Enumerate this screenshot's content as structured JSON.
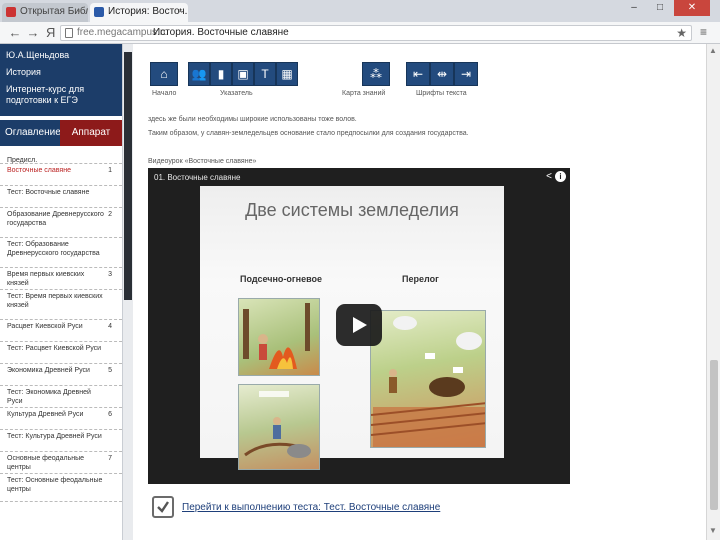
{
  "browser": {
    "tabs": [
      {
        "label": "Открытая Библи..."
      },
      {
        "label": "История: Восточ..."
      }
    ],
    "close_glyph": "×",
    "window_controls": {
      "minimize": "–",
      "maximize": "□",
      "close": "✕"
    },
    "back": "←",
    "forward": "→",
    "yandex_logo": "Я",
    "url": "free.megacampus.ru",
    "page_title": "История. Восточные славяне",
    "star": "★",
    "menu": "≡"
  },
  "sidebar": {
    "header_links": [
      "Ю.А.Щеньдова",
      "История",
      "Интернет-курс для подготовки к ЕГЭ"
    ],
    "tab_toc": "Оглавление",
    "tab_appendix": "Аппарат",
    "items": [
      {
        "label": "Предисл.",
        "num": ""
      },
      {
        "label": "Восточные славяне",
        "num": "1",
        "red": true
      },
      {
        "label": "Тест: Восточные славяне",
        "num": ""
      },
      {
        "label": "Образование Древнерусского государства",
        "num": "2"
      },
      {
        "label": "Тест: Образование Древнерусского государства",
        "num": ""
      },
      {
        "label": "Время первых киевских князей",
        "num": "3"
      },
      {
        "label": "Тест: Время первых киевских князей",
        "num": ""
      },
      {
        "label": "Расцвет Киевской Руси",
        "num": "4"
      },
      {
        "label": "Тест: Расцвет Киевской Руси",
        "num": ""
      },
      {
        "label": "Экономика Древней Руси",
        "num": "5"
      },
      {
        "label": "Тест: Экономика Древней Руси",
        "num": ""
      },
      {
        "label": "Культура Древней Руси",
        "num": "6"
      },
      {
        "label": "Тест: Культура Древней Руси",
        "num": ""
      },
      {
        "label": "Основные феодальные центры",
        "num": "7"
      },
      {
        "label": "Тест: Основные феодальные центры",
        "num": ""
      }
    ]
  },
  "toolbar": {
    "icons": [
      "home-icon",
      "users-icon",
      "book-icon",
      "briefcase-icon",
      "text-icon",
      "calendar-icon",
      "hierarchy-icon",
      "indent-left-icon",
      "indent-mid-icon",
      "indent-right-icon"
    ],
    "glyphs": [
      "⌂",
      "👥",
      "▮",
      "▣",
      "Т",
      "▦",
      "⁂",
      "⇤",
      "⇹",
      "⇥"
    ],
    "labels": {
      "home": "Начало",
      "pointer": "Указатель",
      "map": "Карта знаний",
      "font": "Шрифты текста"
    }
  },
  "content": {
    "paragraph1": "здесь же были необходимы широкие использованы тоже волов.",
    "paragraph2": "Таким образом, у славян-земледельцев основание стало предпосылки для создания государства.",
    "video_caption": "Видеоурок «Восточные славяне»"
  },
  "video": {
    "title": "01. Восточные славяне",
    "share": "<",
    "info": "i",
    "slide_title": "Две системы земледелия",
    "left_label": "Подсечно-огневое",
    "right_label": "Перелог"
  },
  "test_link": "Перейти к выполнению теста: Тест. Восточные славяне",
  "scroll": {
    "up": "▲",
    "down": "▼"
  },
  "colors": {
    "sidebar_blue": "#1c3d69",
    "appendix_red": "#8d1a1a",
    "toolbar_blue": "#234b7e",
    "link_blue": "#1e3f7a"
  }
}
